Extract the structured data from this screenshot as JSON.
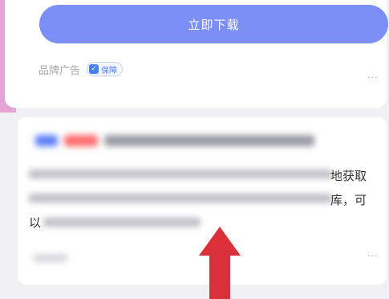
{
  "ad": {
    "download_label": "立即下载",
    "brand_label": "品牌广告",
    "guarantee_label": "保障",
    "more_label": "···"
  },
  "result": {
    "snippet_line1_end": "地获取",
    "snippet_line2_end": "库，可",
    "snippet_line3_start": "以",
    "more_label": "···"
  },
  "colors": {
    "download_button": "#7b8ff6",
    "accent_blue": "#4c7ef3",
    "arrow_red": "#d9303a",
    "side_strip": "#e3a4d6"
  },
  "icons": [
    "shield-icon",
    "more-icon",
    "up-arrow-annotation"
  ]
}
